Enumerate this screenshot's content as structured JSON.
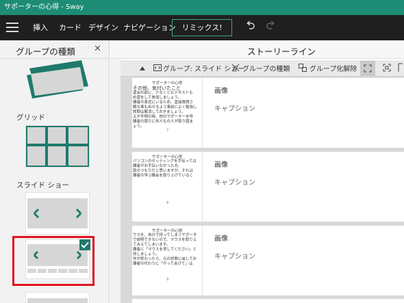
{
  "window": {
    "title": "サポーターの心得 - Sway"
  },
  "menubar": {
    "items": [
      "挿入",
      "カード",
      "デザイン",
      "ナビゲーション"
    ],
    "remix_label": "リミックス!"
  },
  "left_panel": {
    "title": "グループの種類",
    "sections": {
      "grid": "グリッド",
      "slideshow": "スライド ショー"
    }
  },
  "storyline": {
    "title": "ストーリーライン",
    "toolbar": {
      "group_label": "グループ: スライド ショー",
      "group_type": "グループの種類",
      "ungroup": "グループ化解除"
    },
    "rows": [
      {
        "slide_title": "サポーターの心得",
        "slide_lines": [
          "その他、気付いたこと",
          "習会の前に、少なくともテキストも",
          "め習をして参加しましょう。",
          "講者の身近にいるため、直接質問さ",
          "解な事も出せるよう事前によく勉強し",
          "質問は解消しておきましょう。",
          "えが不明の時、他のサポーターを呼",
          "講者の周りに何人もの人が取り囲ま",
          "ょう。"
        ],
        "slide_num": "7",
        "image_label": "画像",
        "caption_label": "キャプション"
      },
      {
        "slide_title": "サポーターの心得",
        "slide_lines": [
          "パソコンのセッティングを手伝っては",
          "講者がお手伝いなかった方。",
          "助のつもりだと思いますが、それは",
          "講者の学ぶ機会を取り上げているこ"
        ],
        "slide_num": "8",
        "image_label": "画像",
        "caption_label": "キャプション"
      },
      {
        "slide_title": "サポーターの心得",
        "slide_lines": [
          "ウスを、自分で持ってしまうサポータ",
          "で説明できないので、マウスを取り上",
          "てみえてしまいます。",
          "講者に「マウスを貸してください」と",
          "持しましょう。",
          "作が終わったら、元の状態に戻してお",
          "講者の代わりに「やってあげて」は"
        ],
        "slide_num": "9",
        "image_label": "画像",
        "caption_label": "キャプション"
      }
    ]
  },
  "colors": {
    "titlebar": "#1d8c74",
    "accent": "#1f7a6c",
    "highlight": "#e0141e"
  }
}
